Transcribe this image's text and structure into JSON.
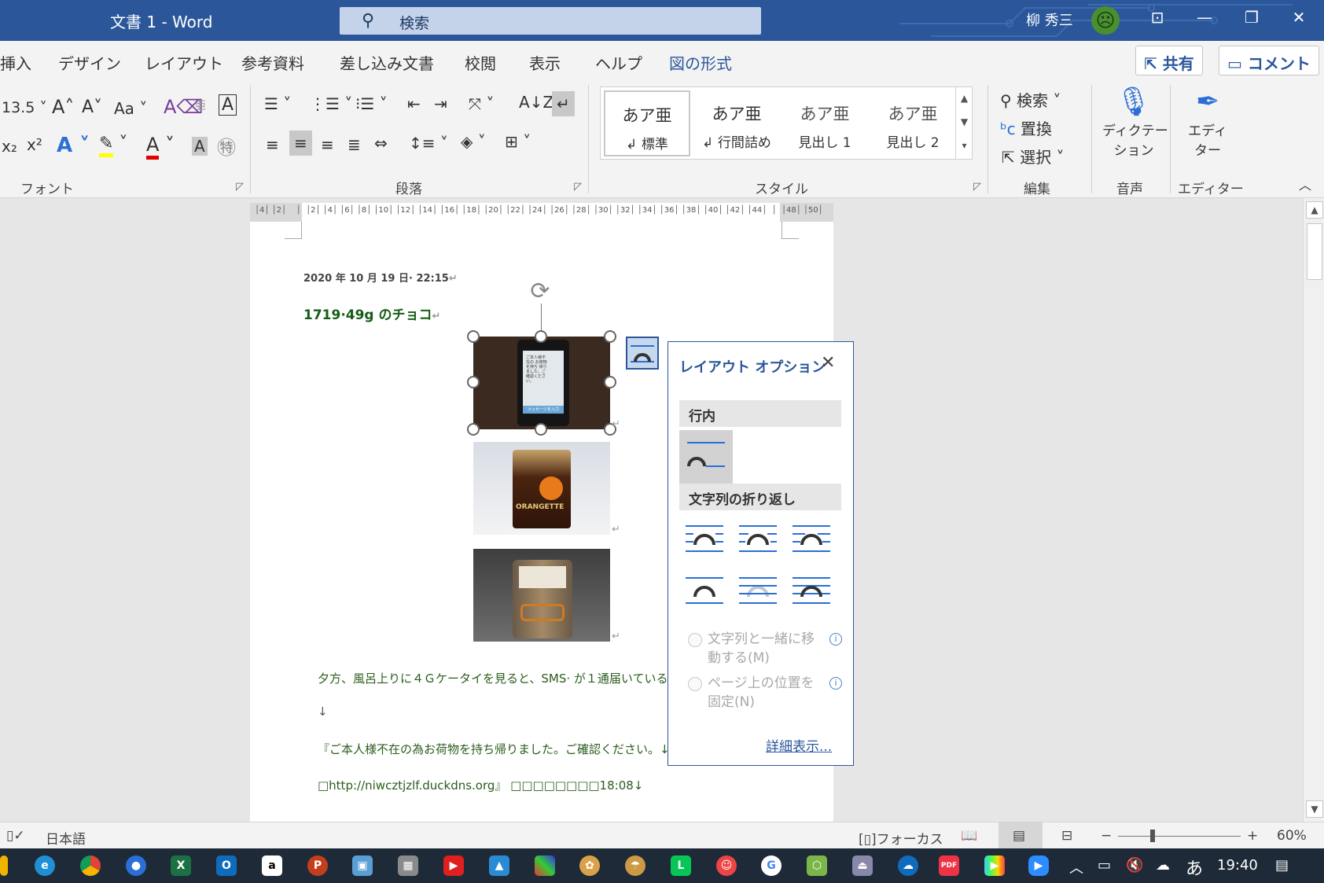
{
  "titlebar": {
    "title": "文書 1  -  Word",
    "search_placeholder": "検索",
    "user_name": "柳 秀三"
  },
  "tabs": [
    {
      "label": "挿入"
    },
    {
      "label": "デザイン"
    },
    {
      "label": "レイアウト"
    },
    {
      "label": "参考資料"
    },
    {
      "label": "差し込み文書"
    },
    {
      "label": "校閲"
    },
    {
      "label": "表示"
    },
    {
      "label": "ヘルプ"
    },
    {
      "label": "図の形式"
    }
  ],
  "share_label": "共有",
  "comment_label": "コメント",
  "ribbon": {
    "font_size": "13.5",
    "change_case": "Aa",
    "groups": {
      "font": "フォント",
      "paragraph": "段落",
      "styles": "スタイル",
      "editing": "編集",
      "voice": "音声",
      "editor": "エディター"
    },
    "styles": [
      {
        "preview": "あア亜",
        "name": "標準"
      },
      {
        "preview": "あア亜",
        "name": "行間詰め"
      },
      {
        "preview": "あア亜",
        "name": "見出し 1"
      },
      {
        "preview": "あア亜",
        "name": "見出し 2"
      }
    ],
    "editing": {
      "find": "検索",
      "replace": "置換",
      "select": "選択"
    },
    "dictate_line1": "ディクテー",
    "dictate_line2": "ション",
    "editor_line1": "エディ",
    "editor_line2": "ター"
  },
  "document": {
    "date_line": "2020 年 10 月 19 日· 22:15",
    "title": "1719·49g のチョコ",
    "lines": [
      "夕方、風呂上りに４Ｇケータイを見ると、SMS· が１通届いている。",
      "↓",
      "『ご本人様不在の為お荷物を持ち帰りました。ご確認ください。↓",
      "□http://niwcztjzlf.duckdns.org』 □□□□□□□□18:08↓"
    ],
    "phone_screen_text": "ご本人様不在の お荷物を持ち 帰りました。ご 確認ください。",
    "phone_button": "メッセージを入力",
    "chocolate_brand": "ORANGETTE"
  },
  "layout_options": {
    "title": "レイアウト オプション",
    "section_inline": "行内",
    "section_wrap": "文字列の折り返し",
    "option_move_line1": "文字列と一緒に移",
    "option_move_line2": "動する(M)",
    "option_fix_line1": "ページ上の位置を",
    "option_fix_line2": "固定(N)",
    "see_more": "詳細表示..."
  },
  "statusbar": {
    "language": "日本語",
    "focus": "フォーカス",
    "zoom": "60%"
  },
  "taskbar": {
    "time": "19:40",
    "ime": "あ"
  },
  "colors": {
    "accent": "#2b579a",
    "doc_text_green": "#2a5d1c"
  }
}
